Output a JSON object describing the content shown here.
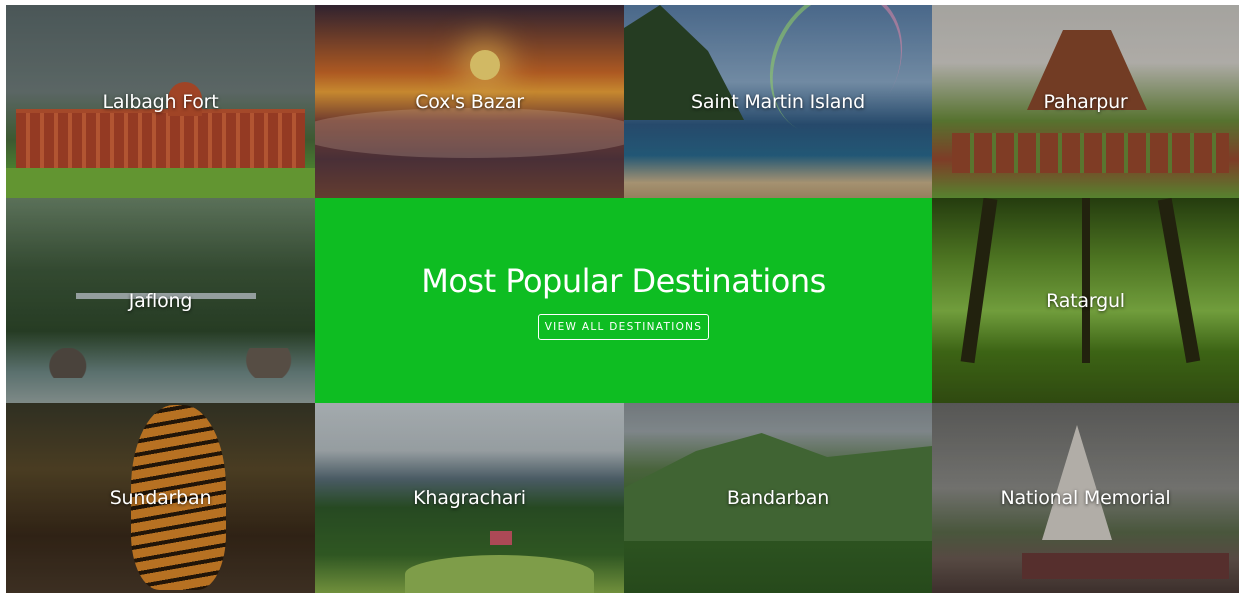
{
  "destinations": {
    "lalbagh": "Lalbagh Fort",
    "cox": "Cox's Bazar",
    "stmartin": "Saint Martin Island",
    "paharpur": "Paharpur",
    "jaflong": "Jaflong",
    "ratargul": "Ratargul",
    "sundarban": "Sundarban",
    "khagrachari": "Khagrachari",
    "bandarban": "Bandarban",
    "memorial": "National Memorial"
  },
  "feature": {
    "title": "Most Popular Destinations",
    "button_label": "VIEW ALL DESTINATIONS",
    "bg_color": "#0ebd22"
  }
}
